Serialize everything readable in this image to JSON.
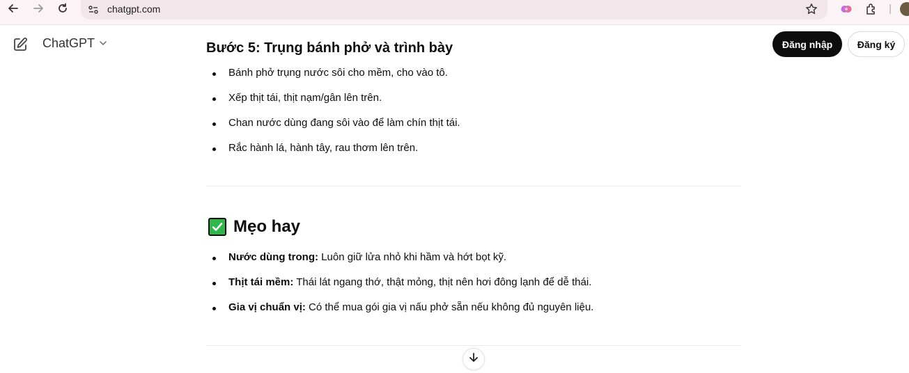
{
  "browser": {
    "url": "chatgpt.com"
  },
  "sidebar": {
    "model_label": "ChatGPT"
  },
  "header": {
    "login_label": "Đăng nhập",
    "signup_label": "Đăng ký"
  },
  "article": {
    "step5_title": "Bước 5: Trụng bánh phở và trình bày",
    "step5_items": [
      "Bánh phở trụng nước sôi cho mềm, cho vào tô.",
      "Xếp thịt tái, thịt nạm/gân lên trên.",
      "Chan nước dùng đang sôi vào để làm chín thịt tái.",
      "Rắc hành lá, hành tây, rau thơm lên trên."
    ],
    "tips_title": "Mẹo hay",
    "tips": [
      {
        "bold": "Nước dùng trong:",
        "text": " Luôn giữ lửa nhỏ khi hầm và hớt bọt kỹ."
      },
      {
        "bold": "Thịt tái mềm:",
        "text": " Thái lát ngang thớ, thật mỏng, thịt nên hơi đông lạnh để dễ thái."
      },
      {
        "bold": "Gia vị chuẩn vị:",
        "text": " Có thể mua gói gia vị nấu phở sẵn nếu không đủ nguyên liệu."
      }
    ]
  },
  "colors": {
    "accent": "#0d0d0d",
    "check_green": "#2db84a"
  }
}
